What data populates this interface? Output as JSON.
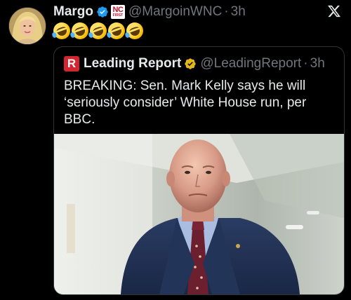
{
  "post": {
    "author": {
      "name": "Margo",
      "handle": "@MargoinWNC",
      "badge_text_top": "NC",
      "badge_text_bottom": "FIRST",
      "verified": true
    },
    "separator": "·",
    "time": "3h",
    "body_emojis": [
      "rolling-on-floor-laughing",
      "rolling-on-floor-laughing",
      "rolling-on-floor-laughing",
      "rolling-on-floor-laughing",
      "rolling-on-floor-laughing"
    ],
    "platform_icon": "x-logo-icon"
  },
  "quote": {
    "logo_letter": "R",
    "author_name": "Leading Report",
    "handle": "@LeadingReport",
    "separator": "·",
    "time": "3h",
    "verified_color": "#e2b719",
    "text": "BREAKING: Sen. Mark Kelly says he will ‘seriously consider’ White House run, per BBC.",
    "image": "photo of a bald man in navy suit and burgundy tie in a hallway"
  },
  "colors": {
    "background": "#000000",
    "text": "#e7e9ea",
    "muted": "#71767b",
    "border": "#2f3336",
    "blue_check": "#1d9bf0",
    "gold_check": "#e2b719",
    "logo_red": "#d22630"
  }
}
